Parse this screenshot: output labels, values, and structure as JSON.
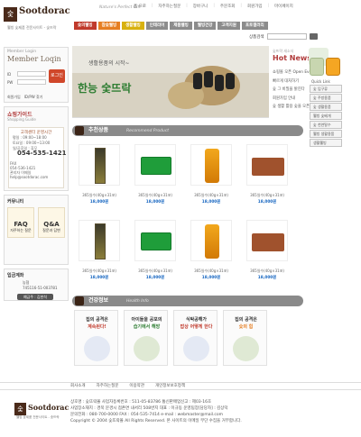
{
  "header": {
    "logo_text": "Sootdorac",
    "logo_char": "숯",
    "logo_tagline": "웰빙 숯제품 전문사이트 - 숯뜨락",
    "slogan": "Nature's Perfect Gift",
    "top_links": [
      "홈 으로",
      "자주하는질문",
      "장바구니",
      "주문조회",
      "회원가입",
      "마이페이지"
    ],
    "nav": [
      {
        "label": "숯의웰빙",
        "color": "#c0392b"
      },
      {
        "label": "참숯웰빙",
        "color": "#e67e22"
      },
      {
        "label": "생활웰빙",
        "color": "#d8b10f"
      },
      {
        "label": "인테리어",
        "color": "#8c8c8c"
      },
      {
        "label": "제품웰빙",
        "color": "#8c8c8c"
      },
      {
        "label": "웰빙건강",
        "color": "#8c8c8c"
      },
      {
        "label": "고객지원",
        "color": "#8c8c8c"
      },
      {
        "label": "포토갤러리",
        "color": "#8c8c8c"
      }
    ],
    "search_label": "상품검색",
    "search_placeholder": ""
  },
  "left": {
    "login": {
      "subtitle": "Member Login",
      "title": "Member Loqin",
      "id_label": "ID",
      "pw_label": "PW",
      "login_button": "로그인",
      "links": [
        "회원가입",
        "ID/PW 찾기"
      ]
    },
    "guide": {
      "title": "쇼핑가이드",
      "subtitle": "Shopping Guide",
      "hours_heading": "고객센터 운영시간",
      "hours": [
        "평일 : 09:00~18:00",
        "토요일 : 09:00~13:00",
        "일/공휴일 : 휴무"
      ],
      "phone": "054-535-1421",
      "fax_label": "FAX",
      "fax": "054-536-1421",
      "email_label": "관리자 이메일",
      "email": "help@sootdorac.com"
    },
    "community": {
      "title": "커뮤니티",
      "faq": "FAQ",
      "faq_sub": "자주하는 질문",
      "qa": "Q&A",
      "qa_sub": "질문과 답변"
    },
    "bank": {
      "title": "입금계좌",
      "bank": "농협",
      "account": "745116-51-003781",
      "owner": "예금주 : 김한석"
    }
  },
  "banner": {
    "caption": "생활용품의 시작~",
    "title": "한능 숯뜨락"
  },
  "hotnews": {
    "label": "숯뜨락 새소식",
    "title": "Hot News",
    "items": [
      "쇼핑몰 오픈 Open Event",
      "빠르게 대처하기",
      "숯 그 비밀을 밝힌다",
      "회원가입 안내",
      "숯 생활 활용 숯을 오픈"
    ]
  },
  "recommend": {
    "title": "추천상품",
    "sub": "Recommend Product",
    "products": [
      {
        "name": "365일수(40g×31포)",
        "price": "18,000원",
        "kind": "stick"
      },
      {
        "name": "365일수(40g×31포)",
        "price": "18,000원",
        "kind": "box"
      },
      {
        "name": "365일수(40g×31포)",
        "price": "18,000원",
        "kind": "can"
      },
      {
        "name": "365일수(40g×31포)",
        "price": "18,000원",
        "kind": "cloth"
      },
      {
        "name": "365일수(40g×31포)",
        "price": "18,000원",
        "kind": "stick"
      },
      {
        "name": "365일수(40g×31포)",
        "price": "18,000원",
        "kind": "box"
      },
      {
        "name": "365일수(40g×31포)",
        "price": "18,000원",
        "kind": "can"
      },
      {
        "name": "365일수(40g×31포)",
        "price": "18,000원",
        "kind": "cloth"
      }
    ]
  },
  "health": {
    "title": "건강정보",
    "sub": "Health Info",
    "cards": [
      {
        "l1": "집의 공격은",
        "l2": "계속된다!",
        "c2": "#c0392b"
      },
      {
        "l1": "아이들을 공포의",
        "l2": "습기에서 해방",
        "c2": "#2e7d32"
      },
      {
        "l1": "식탁공해가",
        "l2": "밥상 어떻게 한다",
        "c2": "#c0392b"
      },
      {
        "l1": "집의 공격은",
        "l2": "숯의 힘",
        "c2": "#e67e22"
      }
    ]
  },
  "quick": {
    "label": "Quick Link",
    "items": [
      "숯 입구류",
      "숯 주방용품",
      "숯 생활용품",
      "웰빙 숯베개",
      "숯 천연탈수",
      "웰빙 생활용품",
      "생활웰빙"
    ]
  },
  "footer": {
    "links": [
      "회사소개",
      "자주하는질문",
      "이용약관",
      "개인정보보호정책"
    ],
    "logo_text": "Sootdorac",
    "logo_tagline": "웰빙 숯제품 전문사이트 - 숯뜨락",
    "lines": [
      "상호명 : 숯뜨락몰   사업자등록번호 : 511-05-83786   통신판매업신고 : 제03-16호",
      "사업장소재지 : 경북 문경시 점촌면 내서리 508번지 대표 : 이규동 운영팀장[담당자] : 김상덕",
      "문의전화 : 080-700-0000  FAX : 054-535-7414  e-mail : webmaster@mail.com",
      "Copyright © 2004 숯뜨락몰 All Rights Reserved.  본 사이트의 이메일 무단 수집을 거부합니다."
    ]
  }
}
